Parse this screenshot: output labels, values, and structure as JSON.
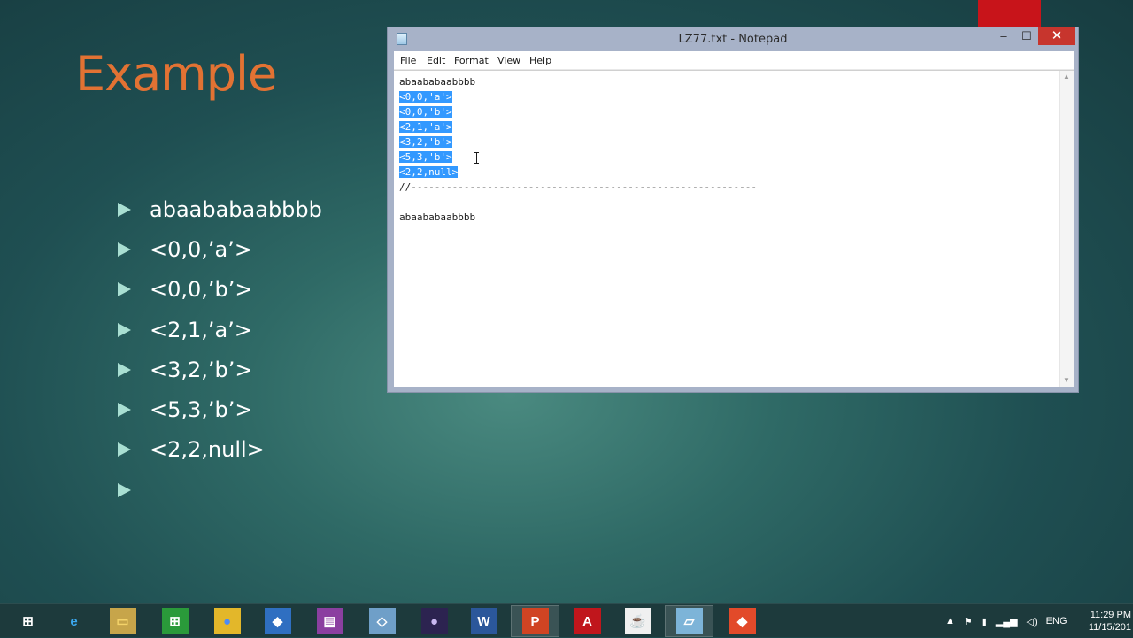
{
  "slide": {
    "title": "Example",
    "bullets": [
      "abaababaabbbb",
      "<0,0,’a’>",
      "<0,0,’b’>",
      "<2,1,’a’>",
      "<3,2,’b’>",
      "<5,3,’b’>",
      "<2,2,null>",
      ""
    ]
  },
  "window": {
    "title": "LZ77.txt - Notepad",
    "controls": {
      "minimize": "–",
      "maximize": "☐",
      "close": "✕"
    },
    "menu": [
      {
        "label": "File"
      },
      {
        "label": "Edit"
      },
      {
        "label": "Format"
      },
      {
        "label": "View"
      },
      {
        "label": "Help"
      }
    ],
    "lines": [
      {
        "text": "abaababaabbbb",
        "selected": false
      },
      {
        "text": "<0,0,'a'>",
        "selected": true
      },
      {
        "text": "<0,0,'b'>",
        "selected": true
      },
      {
        "text": "<2,1,'a'>",
        "selected": true
      },
      {
        "text": "<3,2,'b'>",
        "selected": true
      },
      {
        "text": "<5,3,'b'>",
        "selected": true
      },
      {
        "text": "<2,2,null>",
        "selected": true
      },
      {
        "text": "//-----------------------------------------------------------",
        "selected": false
      },
      {
        "text": "",
        "selected": false
      },
      {
        "text": "abaababaabbbb",
        "selected": false
      }
    ]
  },
  "taskbar": {
    "items": [
      {
        "name": "start-button",
        "glyph": "⊞",
        "color": "#ffffff",
        "bg": "transparent"
      },
      {
        "name": "internet-explorer-icon",
        "glyph": "e",
        "color": "#3ba7ee",
        "bg": "transparent"
      },
      {
        "name": "file-explorer-icon",
        "glyph": "▭",
        "color": "#f4d36a",
        "bg": "#c7a54a"
      },
      {
        "name": "store-icon",
        "glyph": "⊞",
        "color": "#ffffff",
        "bg": "#2a9a3a"
      },
      {
        "name": "chrome-icon",
        "glyph": "●",
        "color": "#4c8bf5",
        "bg": "#e3b72a"
      },
      {
        "name": "defender-icon",
        "glyph": "◆",
        "color": "#ffffff",
        "bg": "#2f6fc1"
      },
      {
        "name": "winrar-icon",
        "glyph": "▤",
        "color": "#ffffff",
        "bg": "#8b3fa0"
      },
      {
        "name": "virtualbox-icon",
        "glyph": "◇",
        "color": "#ffffff",
        "bg": "#6f9fc8"
      },
      {
        "name": "eclipse-icon",
        "glyph": "●",
        "color": "#c9b8f0",
        "bg": "#2c2350"
      },
      {
        "name": "word-icon",
        "glyph": "W",
        "color": "#ffffff",
        "bg": "#2b579a"
      },
      {
        "name": "powerpoint-icon",
        "glyph": "P",
        "color": "#ffffff",
        "bg": "#d04423"
      },
      {
        "name": "acrobat-icon",
        "glyph": "A",
        "color": "#ffffff",
        "bg": "#c0161c"
      },
      {
        "name": "java-icon",
        "glyph": "☕",
        "color": "#e76f00",
        "bg": "#f0f0f0"
      },
      {
        "name": "notepad-icon",
        "glyph": "▱",
        "color": "#ffffff",
        "bg": "#7db4d8"
      },
      {
        "name": "git-icon",
        "glyph": "◆",
        "color": "#ffffff",
        "bg": "#e24a2a"
      }
    ],
    "tray": {
      "up_arrow": "▲",
      "flag": "⚑",
      "device": "▮",
      "network": "▂▄▆",
      "volume": "◁)",
      "lang": "ENG"
    },
    "clock": {
      "time": "11:29 PM",
      "date": "11/15/201"
    }
  }
}
